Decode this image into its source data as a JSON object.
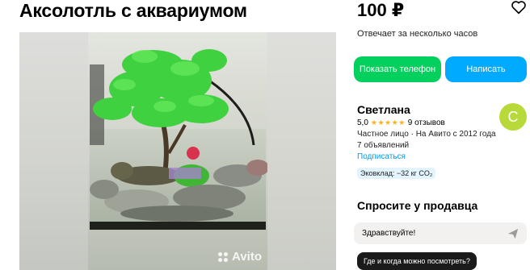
{
  "listing": {
    "title": "Аксолотль с аквариумом",
    "price": "100 ₽",
    "reply_time": "Отвечает за несколько часов",
    "watermark": "Avito"
  },
  "actions": {
    "show_phone": "Показать телефон",
    "write": "Написать"
  },
  "seller": {
    "name": "Светлана",
    "avatar_letter": "С",
    "rating_value": "5,0",
    "stars": "★★★★★",
    "reviews": "9 отзывов",
    "type": "Частное лицо · На Авито с 2012 года",
    "ads_count": "7 объявлений",
    "subscribe": "Подписаться",
    "eco": "Эковклад: −32 кг CO₂"
  },
  "ask": {
    "title": "Спросите у продавца",
    "input_value": "Здравствуйте!",
    "suggestion": "Где и когда можно посмотреть?"
  },
  "colors": {
    "green": "#04d05d",
    "blue": "#00aaff",
    "link": "#0099f7",
    "avatar": "#b7d93a",
    "star": "#ffb021"
  }
}
